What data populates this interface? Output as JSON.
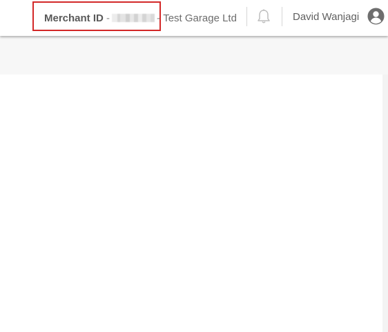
{
  "header": {
    "merchant_label": "Merchant ID",
    "merchant_id_separator": "-",
    "company_separator": "-",
    "company_name": "Test Garage Ltd",
    "user_name": "David Wanjagi"
  },
  "icons": {
    "notifications": "bell-icon",
    "account": "user-circle-icon"
  },
  "colors": {
    "highlight": "#d32727",
    "text": "#5f5f5f",
    "header_bg": "#ffffff",
    "page_bg": "#f7f7f7"
  }
}
